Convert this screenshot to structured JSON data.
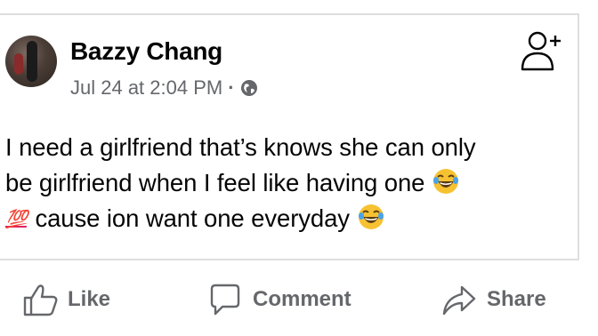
{
  "post": {
    "author": "Bazzy Chang",
    "date": "Jul 24 at 2:04 PM",
    "separator": "·",
    "privacy_icon": "globe-icon",
    "text_line1": "I need a girlfriend that’s knows she can only",
    "text_line2": "be girlfriend when I feel like having one",
    "text_line3_emoji": "💯",
    "text_line3": "cause ion want one everyday"
  },
  "actions": {
    "like": "Like",
    "comment": "Comment",
    "share": "Share"
  },
  "icons": {
    "add_friend": "add-friend-icon",
    "laugh": "laughing-emoji-icon"
  },
  "colors": {
    "text": "#050505",
    "secondary": "#65676b",
    "border": "#dedede"
  }
}
